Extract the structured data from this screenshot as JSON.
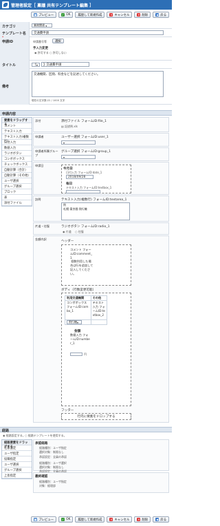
{
  "header": {
    "title": "管理者設定［ 稟議 共有テンプレート編集 ］"
  },
  "buttons": {
    "preview": "プレビュー",
    "ok": "OK",
    "save_new": "履歴して新規作成",
    "cancel": "キャンセル",
    "delete": "削除",
    "back": "戻る"
  },
  "form": {
    "category_label": "カテゴリ",
    "category_value": "業務関連",
    "template_name_label": "テンプレート名",
    "template_name_value": "交通費申請",
    "application_id_label": "申請ID",
    "application_no_text": "申請番号等",
    "select_label": "選択",
    "manual_change_label": "手入力変更",
    "allow": "許可する",
    "deny": "許可しない",
    "title_label": "タイトル",
    "title_format": "【",
    "title_value": "】交通費申請",
    "remarks_label": "備考",
    "remarks_value": "交通機関、区間、料金などを記述してください。",
    "remarks_count": "現在の文字数:22 / 1000 文字"
  },
  "content": {
    "section": "申請内容",
    "palette_title": "要素をドラッグする",
    "palette": [
      "コメント",
      "テキスト入力",
      "テキスト入力(複数行)",
      "日付入力",
      "数値入力",
      "ラジオボタン",
      "コンボボックス",
      "チェックボックス",
      "自動計算（合計）",
      "自動計算（その他）",
      "ユーザ選択",
      "グループ選択",
      "ブロック",
      "表",
      "添付ファイル"
    ],
    "fields": {
      "attach_label": "添付",
      "attach_text": "添付ファイル フォームID:file_1",
      "attach_file": "記述例.xls",
      "applicant_label": "申請者",
      "applicant_text": "ユーザー選択 フォームID:user_1",
      "group_label": "申請者所属グループ",
      "group_text": "グループ選択 フォームID:group_1",
      "date_label": "申請日",
      "today": "今月日",
      "date_text": "日付入力 フォームID:date_1",
      "date_value": "2018/09/28",
      "month": "毎日",
      "month_text": "テキスト入力 フォームID:textbox_1",
      "detail_label": "訪問",
      "detail_text": "テキスト入力(複数行) フォームID:textarea_1",
      "detail_value": "例\n札幌-東京間 飛行機",
      "trip_label": "片道・往復",
      "trip_text": "ラジオボタン フォームID:radio_1",
      "oneway": "片道",
      "round": "往復",
      "amount_label": "金額内訳",
      "header_text": "ヘッダー",
      "comment_text": "コメント フォームID:comment_1 \n 個数利用した場合は行を追加して記入してください。",
      "body_text": "ボディ（行数変更可能）",
      "col1": "利用交通機関",
      "col2": "その他",
      "combo_text": "コンボボックス フォームID:combo_1",
      "text2": "テキスト入力 フォームID:textbox_2",
      "sel_default": "飛行機",
      "amount_small": "金額",
      "num_text": "数値入力 フォームID:number_1",
      "yen": "円",
      "footer_text": "フッター",
      "drop_text": "行内に要素をドロップする"
    }
  },
  "route": {
    "section": "経路",
    "opt1": "経路設定する。",
    "opt2": "経路テンプレートを使用する。",
    "palette_title": "経路要素をドラッグする",
    "palette": [
      "任意設定",
      "ユーザ指定",
      "役職指定",
      "ユーザ選択",
      "グループ選択",
      "上長指定"
    ],
    "approval_title": "承認経路",
    "approval": [
      [
        "経路種別",
        "ユーザ指定"
      ],
      [
        "選択対象",
        "制限なし"
      ],
      [
        "承認設定",
        "全員の承認"
      ]
    ],
    "approval2": [
      [
        "経路種別",
        "ユーザ選択"
      ],
      [
        "選択対象",
        "制限なし"
      ],
      [
        "承認設定",
        "全員の承認"
      ]
    ],
    "final_title": "最終確認",
    "final": [
      [
        "経路種別",
        "ユーザ指定"
      ],
      [
        "対象",
        "経理部"
      ]
    ]
  }
}
